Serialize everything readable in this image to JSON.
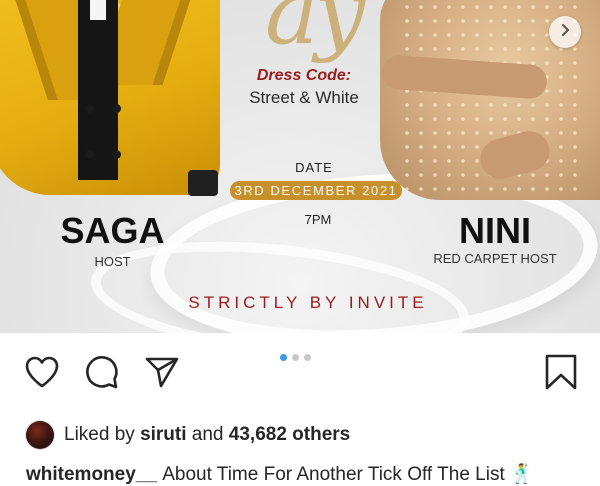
{
  "post_image": {
    "dress_code_label": "Dress Code:",
    "dress_code_value": "Street & White",
    "date_label": "DATE",
    "date_value": "3RD DECEMBER 2021",
    "time_value": "7PM",
    "host_name": "SAGA",
    "host_role": "HOST",
    "red_carpet_host_name": "NINI",
    "red_carpet_host_role": "RED CARPET HOST",
    "invite_note": "STRICTLY BY INVITE"
  },
  "carousel": {
    "total_slides": 3,
    "active_slide": 1,
    "next_icon": "chevron-right-icon"
  },
  "actions": {
    "like_icon": "heart-icon",
    "comment_icon": "comment-icon",
    "share_icon": "send-icon",
    "save_icon": "bookmark-icon"
  },
  "likes": {
    "prefix": "Liked by",
    "user": "siruti",
    "conjunction": "and",
    "others": "43,682 others"
  },
  "caption": {
    "username": "whitemoney__",
    "text": "About Time For Another Tick Off The List 🕺"
  },
  "colors": {
    "accent_red": "#9b1c1c",
    "gold": "#c8902a",
    "carousel_active": "#3897f0"
  }
}
